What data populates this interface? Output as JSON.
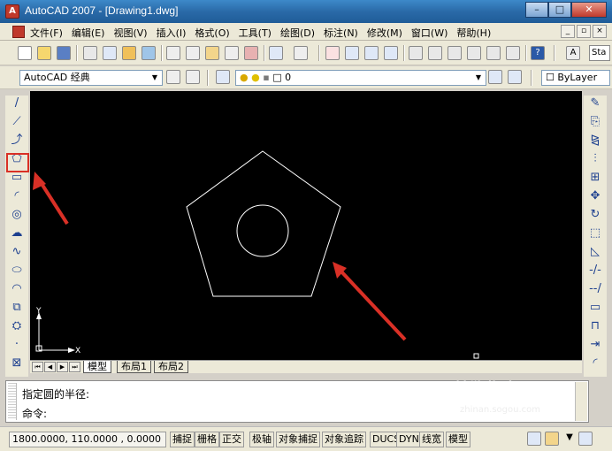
{
  "window": {
    "title": "AutoCAD 2007 - [Drawing1.dwg]",
    "app_icon_glyph": "A",
    "controls": {
      "minimize": "–",
      "maximize": "□",
      "close": "✕"
    }
  },
  "menu": {
    "items": [
      "文件(F)",
      "编辑(E)",
      "视图(V)",
      "插入(I)",
      "格式(O)",
      "工具(T)",
      "绘图(D)",
      "标注(N)",
      "修改(M)",
      "窗口(W)",
      "帮助(H)"
    ],
    "mdi_controls": {
      "minimize": "_",
      "restore": "▫",
      "close": "×"
    }
  },
  "toolbar_standard": {
    "text_style_value": "Sta"
  },
  "toolbar_workspace": {
    "workspace_value": "AutoCAD 经典",
    "layer_value": "0",
    "color_value": "ByLayer"
  },
  "left_tools": [
    {
      "name": "line-icon",
      "glyph": "/"
    },
    {
      "name": "construction-line-icon",
      "glyph": "⟋"
    },
    {
      "name": "polyline-icon",
      "glyph": "⤴"
    },
    {
      "name": "polygon-icon",
      "glyph": "⬠"
    },
    {
      "name": "rectangle-icon",
      "glyph": "▭"
    },
    {
      "name": "arc-icon",
      "glyph": "◜"
    },
    {
      "name": "circle-icon",
      "glyph": "◎"
    },
    {
      "name": "revcloud-icon",
      "glyph": "☁"
    },
    {
      "name": "spline-icon",
      "glyph": "∿"
    },
    {
      "name": "ellipse-icon",
      "glyph": "⬭"
    },
    {
      "name": "ellipse-arc-icon",
      "glyph": "◠"
    },
    {
      "name": "insert-block-icon",
      "glyph": "⧉"
    },
    {
      "name": "make-block-icon",
      "glyph": "⛭"
    },
    {
      "name": "point-icon",
      "glyph": "·"
    },
    {
      "name": "hatch-icon",
      "glyph": "⊠"
    }
  ],
  "right_tools": [
    {
      "name": "erase-icon",
      "glyph": "✎"
    },
    {
      "name": "copy-icon",
      "glyph": "⎘"
    },
    {
      "name": "mirror-icon",
      "glyph": "⧎"
    },
    {
      "name": "offset-icon",
      "glyph": "⫶"
    },
    {
      "name": "array-icon",
      "glyph": "⊞"
    },
    {
      "name": "move-icon",
      "glyph": "✥"
    },
    {
      "name": "rotate-icon",
      "glyph": "↻"
    },
    {
      "name": "scale-icon",
      "glyph": "⬚"
    },
    {
      "name": "stretch-icon",
      "glyph": "◺"
    },
    {
      "name": "trim-icon",
      "glyph": "-/-"
    },
    {
      "name": "extend-icon",
      "glyph": "--/"
    },
    {
      "name": "break-icon",
      "glyph": "▭"
    },
    {
      "name": "join-icon",
      "glyph": "⊓"
    },
    {
      "name": "chamfer-icon",
      "glyph": "⇥"
    },
    {
      "name": "fillet-icon",
      "glyph": "◜"
    }
  ],
  "tabs": {
    "model": "模型",
    "layout1": "布局1",
    "layout2": "布局2"
  },
  "ucs": {
    "x_label": "X",
    "y_label": "Y"
  },
  "command": {
    "history": "指定圆的半径:",
    "prompt": "命令:"
  },
  "status": {
    "coords": "1800.0000, 110.0000 , 0.0000",
    "buttons": [
      "捕捉",
      "栅格",
      "正交",
      "极轴",
      "对象捕捉",
      "对象追踪",
      "DUCS",
      "DYN",
      "线宽",
      "模型"
    ]
  },
  "watermark": {
    "text": "搜狗指南",
    "url": "zhinan.sogou.com"
  },
  "colors": {
    "canvas": "#000000",
    "drawing": "#ffffff",
    "annotation": "#d93026"
  }
}
